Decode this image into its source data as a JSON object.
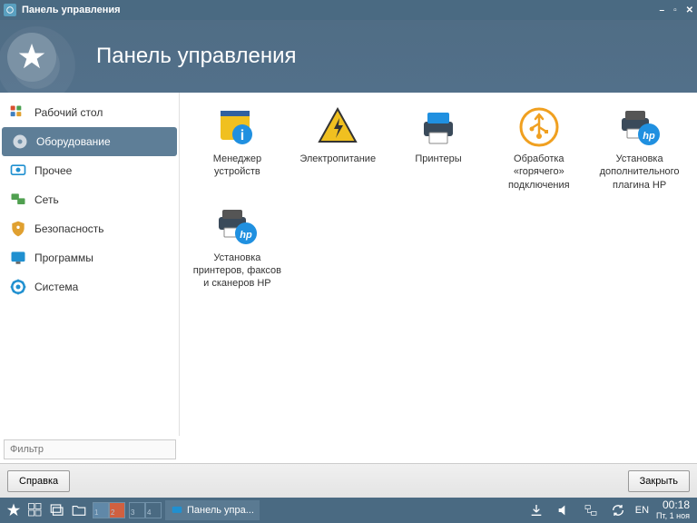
{
  "titlebar": {
    "title": "Панель управления"
  },
  "header": {
    "title": "Панель управления"
  },
  "sidebar": {
    "items": [
      {
        "label": "Рабочий стол"
      },
      {
        "label": "Оборудование"
      },
      {
        "label": "Прочее"
      },
      {
        "label": "Сеть"
      },
      {
        "label": "Безопасность"
      },
      {
        "label": "Программы"
      },
      {
        "label": "Система"
      }
    ]
  },
  "grid": {
    "items": [
      {
        "label": "Менеджер устройств"
      },
      {
        "label": "Электропитание"
      },
      {
        "label": "Принтеры"
      },
      {
        "label": "Обработка «горячего» подключения"
      },
      {
        "label": "Установка дополнительного плагина HP"
      },
      {
        "label": "Установка принтеров, факсов и сканеров HP"
      }
    ]
  },
  "filter": {
    "placeholder": "Фильтр"
  },
  "footer": {
    "help": "Справка",
    "close": "Закрыть"
  },
  "taskbar": {
    "app_label": "Панель упра...",
    "lang": "EN",
    "time": "00:18",
    "date": "Пт, 1 ноя"
  }
}
